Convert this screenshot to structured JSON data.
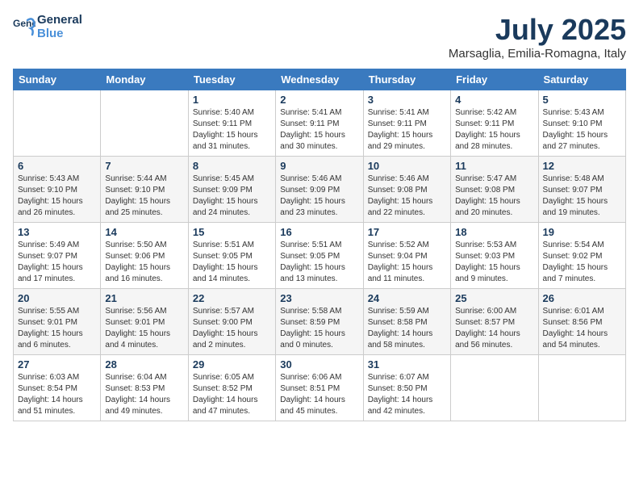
{
  "header": {
    "logo_line1": "General",
    "logo_line2": "Blue",
    "month_title": "July 2025",
    "location": "Marsaglia, Emilia-Romagna, Italy"
  },
  "weekdays": [
    "Sunday",
    "Monday",
    "Tuesday",
    "Wednesday",
    "Thursday",
    "Friday",
    "Saturday"
  ],
  "weeks": [
    [
      {
        "day": "",
        "info": ""
      },
      {
        "day": "",
        "info": ""
      },
      {
        "day": "1",
        "info": "Sunrise: 5:40 AM\nSunset: 9:11 PM\nDaylight: 15 hours\nand 31 minutes."
      },
      {
        "day": "2",
        "info": "Sunrise: 5:41 AM\nSunset: 9:11 PM\nDaylight: 15 hours\nand 30 minutes."
      },
      {
        "day": "3",
        "info": "Sunrise: 5:41 AM\nSunset: 9:11 PM\nDaylight: 15 hours\nand 29 minutes."
      },
      {
        "day": "4",
        "info": "Sunrise: 5:42 AM\nSunset: 9:11 PM\nDaylight: 15 hours\nand 28 minutes."
      },
      {
        "day": "5",
        "info": "Sunrise: 5:43 AM\nSunset: 9:10 PM\nDaylight: 15 hours\nand 27 minutes."
      }
    ],
    [
      {
        "day": "6",
        "info": "Sunrise: 5:43 AM\nSunset: 9:10 PM\nDaylight: 15 hours\nand 26 minutes."
      },
      {
        "day": "7",
        "info": "Sunrise: 5:44 AM\nSunset: 9:10 PM\nDaylight: 15 hours\nand 25 minutes."
      },
      {
        "day": "8",
        "info": "Sunrise: 5:45 AM\nSunset: 9:09 PM\nDaylight: 15 hours\nand 24 minutes."
      },
      {
        "day": "9",
        "info": "Sunrise: 5:46 AM\nSunset: 9:09 PM\nDaylight: 15 hours\nand 23 minutes."
      },
      {
        "day": "10",
        "info": "Sunrise: 5:46 AM\nSunset: 9:08 PM\nDaylight: 15 hours\nand 22 minutes."
      },
      {
        "day": "11",
        "info": "Sunrise: 5:47 AM\nSunset: 9:08 PM\nDaylight: 15 hours\nand 20 minutes."
      },
      {
        "day": "12",
        "info": "Sunrise: 5:48 AM\nSunset: 9:07 PM\nDaylight: 15 hours\nand 19 minutes."
      }
    ],
    [
      {
        "day": "13",
        "info": "Sunrise: 5:49 AM\nSunset: 9:07 PM\nDaylight: 15 hours\nand 17 minutes."
      },
      {
        "day": "14",
        "info": "Sunrise: 5:50 AM\nSunset: 9:06 PM\nDaylight: 15 hours\nand 16 minutes."
      },
      {
        "day": "15",
        "info": "Sunrise: 5:51 AM\nSunset: 9:05 PM\nDaylight: 15 hours\nand 14 minutes."
      },
      {
        "day": "16",
        "info": "Sunrise: 5:51 AM\nSunset: 9:05 PM\nDaylight: 15 hours\nand 13 minutes."
      },
      {
        "day": "17",
        "info": "Sunrise: 5:52 AM\nSunset: 9:04 PM\nDaylight: 15 hours\nand 11 minutes."
      },
      {
        "day": "18",
        "info": "Sunrise: 5:53 AM\nSunset: 9:03 PM\nDaylight: 15 hours\nand 9 minutes."
      },
      {
        "day": "19",
        "info": "Sunrise: 5:54 AM\nSunset: 9:02 PM\nDaylight: 15 hours\nand 7 minutes."
      }
    ],
    [
      {
        "day": "20",
        "info": "Sunrise: 5:55 AM\nSunset: 9:01 PM\nDaylight: 15 hours\nand 6 minutes."
      },
      {
        "day": "21",
        "info": "Sunrise: 5:56 AM\nSunset: 9:01 PM\nDaylight: 15 hours\nand 4 minutes."
      },
      {
        "day": "22",
        "info": "Sunrise: 5:57 AM\nSunset: 9:00 PM\nDaylight: 15 hours\nand 2 minutes."
      },
      {
        "day": "23",
        "info": "Sunrise: 5:58 AM\nSunset: 8:59 PM\nDaylight: 15 hours\nand 0 minutes."
      },
      {
        "day": "24",
        "info": "Sunrise: 5:59 AM\nSunset: 8:58 PM\nDaylight: 14 hours\nand 58 minutes."
      },
      {
        "day": "25",
        "info": "Sunrise: 6:00 AM\nSunset: 8:57 PM\nDaylight: 14 hours\nand 56 minutes."
      },
      {
        "day": "26",
        "info": "Sunrise: 6:01 AM\nSunset: 8:56 PM\nDaylight: 14 hours\nand 54 minutes."
      }
    ],
    [
      {
        "day": "27",
        "info": "Sunrise: 6:03 AM\nSunset: 8:54 PM\nDaylight: 14 hours\nand 51 minutes."
      },
      {
        "day": "28",
        "info": "Sunrise: 6:04 AM\nSunset: 8:53 PM\nDaylight: 14 hours\nand 49 minutes."
      },
      {
        "day": "29",
        "info": "Sunrise: 6:05 AM\nSunset: 8:52 PM\nDaylight: 14 hours\nand 47 minutes."
      },
      {
        "day": "30",
        "info": "Sunrise: 6:06 AM\nSunset: 8:51 PM\nDaylight: 14 hours\nand 45 minutes."
      },
      {
        "day": "31",
        "info": "Sunrise: 6:07 AM\nSunset: 8:50 PM\nDaylight: 14 hours\nand 42 minutes."
      },
      {
        "day": "",
        "info": ""
      },
      {
        "day": "",
        "info": ""
      }
    ]
  ]
}
